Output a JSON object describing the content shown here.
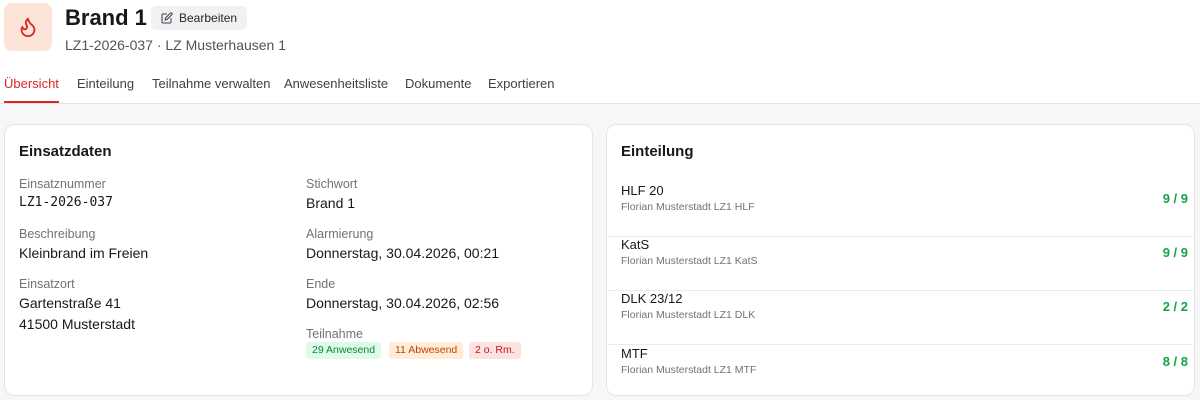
{
  "header": {
    "title": "Brand 1",
    "edit_label": "Bearbeiten",
    "subtitle": "LZ1-2026-037 · LZ Musterhausen 1",
    "icon": "flame-icon",
    "icon_color": "#dc2626"
  },
  "tabs": [
    {
      "label": "Übersicht",
      "active": true
    },
    {
      "label": "Einteilung"
    },
    {
      "label": "Teilnahme verwalten"
    },
    {
      "label": "Anwesenheitsliste"
    },
    {
      "label": "Dokumente"
    },
    {
      "label": "Exportieren"
    }
  ],
  "einsatzdaten": {
    "title": "Einsatzdaten",
    "einsatznummer_label": "Einsatznummer",
    "einsatznummer": "LZ1-2026-037",
    "stichwort_label": "Stichwort",
    "stichwort": "Brand 1",
    "beschreibung_label": "Beschreibung",
    "beschreibung": "Kleinbrand im Freien",
    "alarmierung_label": "Alarmierung",
    "alarmierung": "Donnerstag, 30.04.2026, 00:21",
    "einsatzort_label": "Einsatzort",
    "einsatzort_line1": "Gartenstraße 41",
    "einsatzort_line2": "41500 Musterstadt",
    "ende_label": "Ende",
    "ende": "Donnerstag, 30.04.2026, 02:56",
    "teilnahme_label": "Teilnahme",
    "badges": {
      "anwesend": "29 Anwesend",
      "abwesend": "11 Abwesend",
      "ohne_rm": "2 o. Rm."
    }
  },
  "einteilung": {
    "title": "Einteilung",
    "units": [
      {
        "name": "HLF 20",
        "callsign": "Florian Musterstadt LZ1 HLF",
        "count": "9 / 9"
      },
      {
        "name": "KatS",
        "callsign": "Florian Musterstadt LZ1 KatS",
        "count": "9 / 9"
      },
      {
        "name": "DLK 23/12",
        "callsign": "Florian Musterstadt LZ1 DLK",
        "count": "2 / 2"
      },
      {
        "name": "MTF",
        "callsign": "Florian Musterstadt LZ1 MTF",
        "count": "8 / 8"
      }
    ]
  }
}
